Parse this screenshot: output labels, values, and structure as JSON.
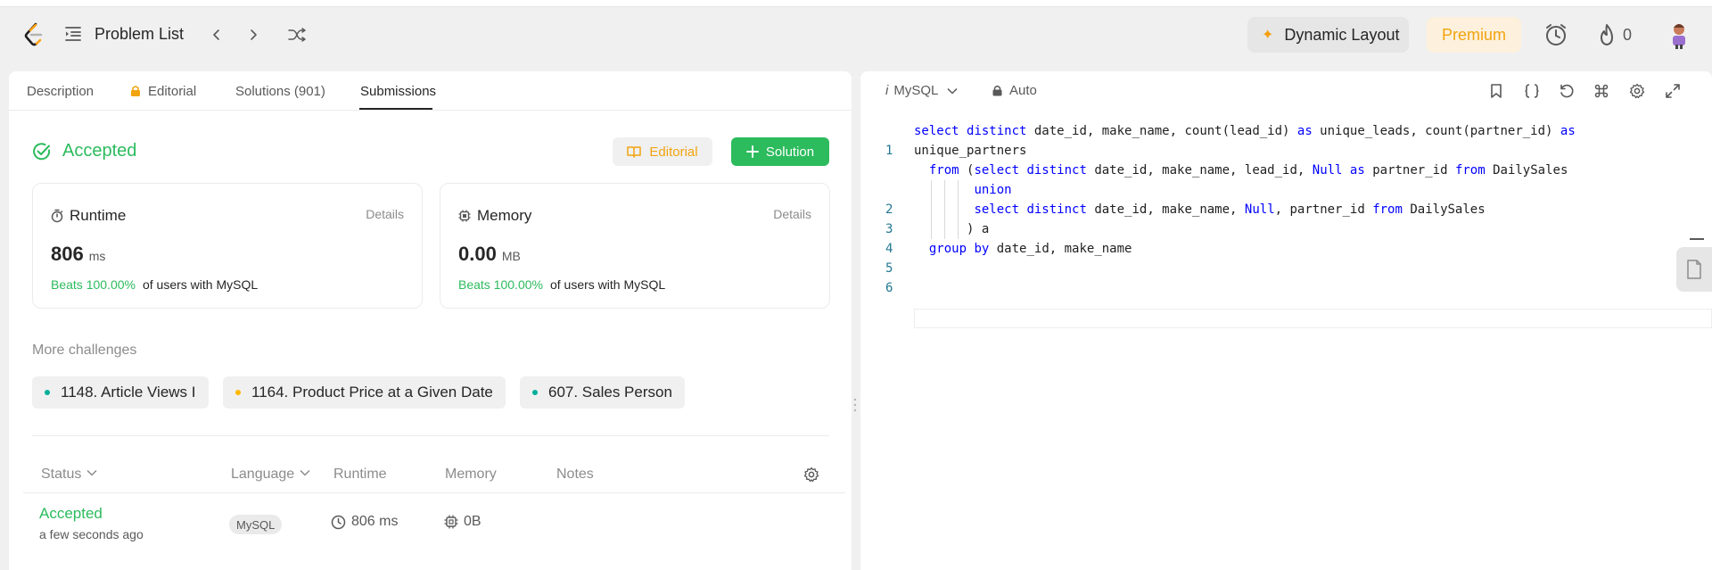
{
  "navbar": {
    "problem_list_label": "Problem List",
    "dynamic_layout_label": "Dynamic Layout",
    "premium_label": "Premium",
    "streak_count": "0"
  },
  "tabs": {
    "description": "Description",
    "editorial": "Editorial",
    "solutions": "Solutions (901)",
    "submissions": "Submissions"
  },
  "result": {
    "status": "Accepted",
    "editorial_button": "Editorial",
    "solution_button": "Solution",
    "runtime": {
      "title": "Runtime",
      "details": "Details",
      "value": "806",
      "unit": "ms",
      "beats": "Beats 100.00%",
      "beats_suffix": "of users with MySQL"
    },
    "memory": {
      "title": "Memory",
      "details": "Details",
      "value": "0.00",
      "unit": "MB",
      "beats": "Beats 100.00%",
      "beats_suffix": "of users with MySQL"
    }
  },
  "more_challenges": {
    "label": "More challenges",
    "items": [
      {
        "label": "1148. Article Views I",
        "dot_color": "#00af9b"
      },
      {
        "label": "1164. Product Price at a Given Date",
        "dot_color": "#ffb800"
      },
      {
        "label": "607. Sales Person",
        "dot_color": "#00af9b"
      }
    ]
  },
  "table": {
    "headers": {
      "status": "Status",
      "language": "Language",
      "runtime": "Runtime",
      "memory": "Memory",
      "notes": "Notes"
    },
    "rows": [
      {
        "status": "Accepted",
        "time": "a few seconds ago",
        "language": "MySQL",
        "runtime": "806 ms",
        "memory": "0B"
      }
    ]
  },
  "editor": {
    "language": "MySQL",
    "mode": "Auto",
    "line_numbers": [
      "1",
      "2",
      "3",
      "4",
      "5",
      "6"
    ],
    "code_lines": [
      "select distinct date_id, make_name, count(lead_id) as unique_leads, count(partner_id) as",
      "unique_partners",
      "  from (select distinct date_id, make_name, lead_id, Null as partner_id from DailySales",
      "        union",
      "        select distinct date_id, make_name, Null, partner_id from DailySales",
      "       ) a",
      "  group by date_id, make_name"
    ]
  },
  "colors": {
    "accepted_green": "#2cbb5d",
    "premium_orange": "#f2a40f",
    "sql_keyword": "#0000ff"
  }
}
